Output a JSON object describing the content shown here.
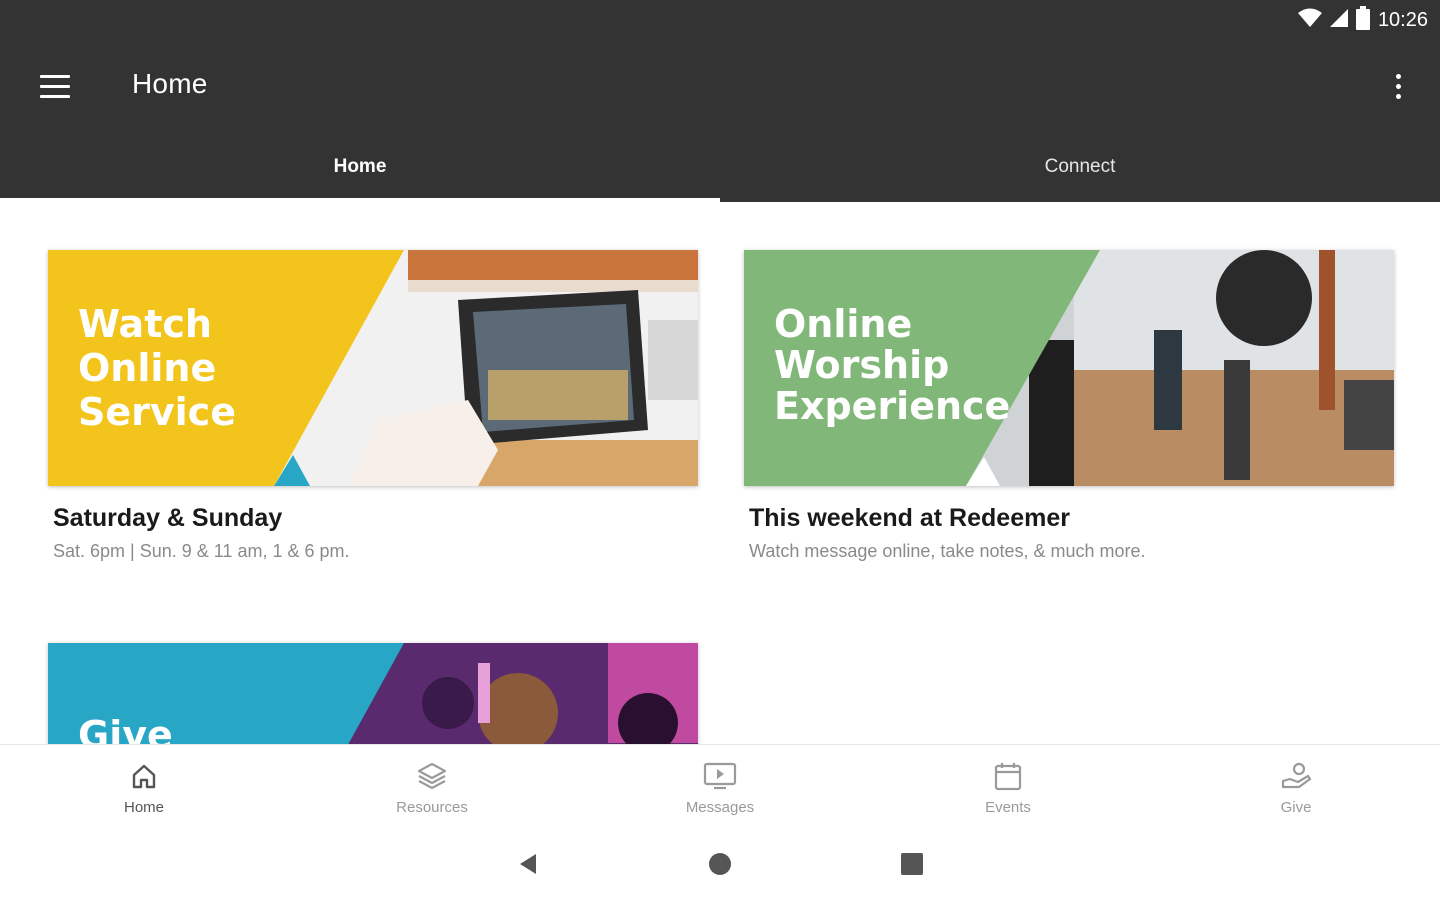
{
  "status_bar": {
    "time": "10:26",
    "icons": [
      "wifi-icon",
      "signal-icon",
      "battery-icon"
    ]
  },
  "app_bar": {
    "title": "Home",
    "menu_icon": "hamburger-menu-icon",
    "overflow_icon": "more-vert-icon"
  },
  "tabs": [
    {
      "label": "Home",
      "active": true
    },
    {
      "label": "Connect",
      "active": false
    }
  ],
  "cards": [
    {
      "headline": [
        "Watch",
        "Online",
        "Service"
      ],
      "title": "Saturday & Sunday",
      "subtitle": "Sat. 6pm | Sun. 9 & 11 am, 1 & 6 pm.",
      "accent": "#f2c41c"
    },
    {
      "headline": [
        "Online",
        "Worship",
        "Experience"
      ],
      "title": "This weekend at Redeemer",
      "subtitle": "Watch message online, take notes, & much more.",
      "accent": "#82b77a"
    },
    {
      "headline": [
        "Give"
      ],
      "accent": "#27a6c5"
    }
  ],
  "bottom_nav": [
    {
      "label": "Home",
      "icon": "home-icon",
      "active": true
    },
    {
      "label": "Resources",
      "icon": "layers-icon",
      "active": false
    },
    {
      "label": "Messages",
      "icon": "video-screen-icon",
      "active": false
    },
    {
      "label": "Events",
      "icon": "calendar-icon",
      "active": false
    },
    {
      "label": "Give",
      "icon": "hand-giving-icon",
      "active": false
    }
  ],
  "system_nav": {
    "icons": [
      "back-icon",
      "home-circle-icon",
      "recents-icon"
    ]
  },
  "colors": {
    "appbar": "#333333",
    "yellow": "#f2c41c",
    "green": "#82b77a",
    "teal": "#27a6c5"
  }
}
